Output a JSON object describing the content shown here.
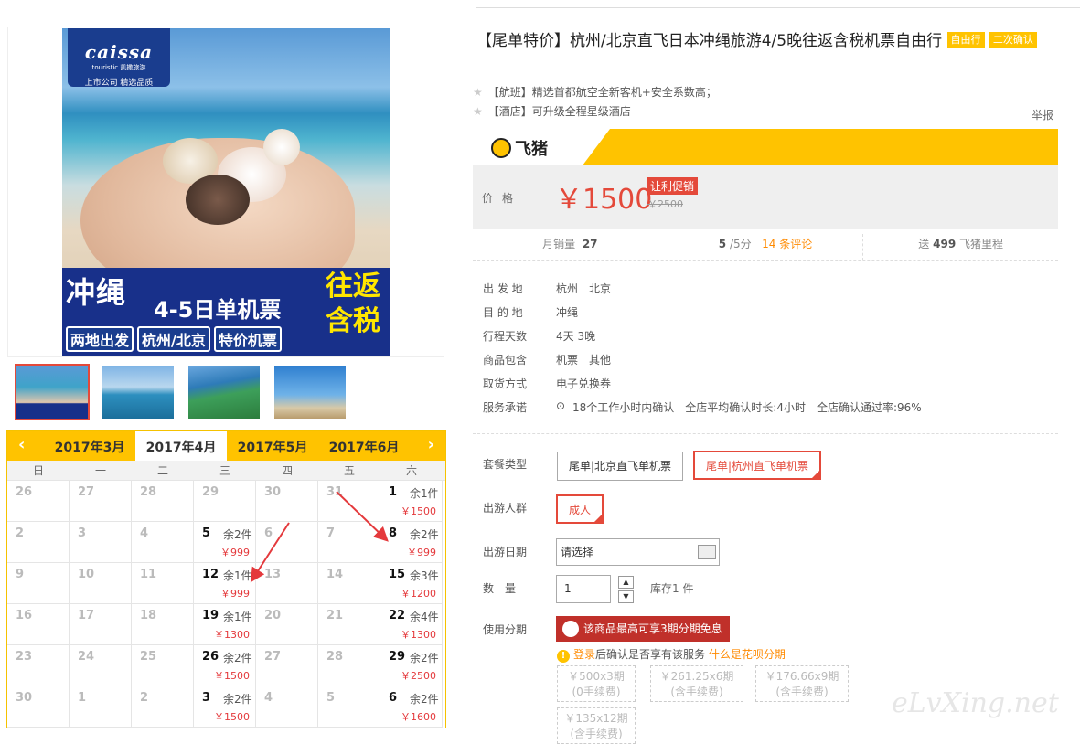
{
  "product": {
    "title": "【尾单特价】杭州/北京直飞日本冲绳旅游4/5晚往返含税机票自由行",
    "badge1": "自由行",
    "badge2": "二次确认",
    "features": [
      "【航班】精选首都航空全新客机+安全系数高；",
      "【酒店】可升级全程星级酒店"
    ],
    "report": "举报"
  },
  "poster": {
    "brand": "caissa",
    "brand_sub": "touristic 凯撒旅游",
    "brand_tag": "上市公司 精选品质",
    "headline": "冲绳",
    "subhead": "4-5日单机票",
    "tags": [
      "两地出发",
      "杭州/北京",
      "特价机票"
    ],
    "side1": "往返",
    "side2": "含税"
  },
  "feizhu": {
    "logo": "飞猪"
  },
  "price": {
    "label": "价格",
    "current": "￥1500",
    "promo": "让利促销",
    "original": "￥2500"
  },
  "stats": {
    "sales_label": "月销量",
    "sales": "27",
    "rating": "5",
    "rating_unit": "/5分",
    "reviews": "14 条评论",
    "points_prefix": "送",
    "points": "499",
    "points_suffix": "飞猪里程"
  },
  "info": [
    {
      "label": "出 发 地",
      "value": "杭州　北京"
    },
    {
      "label": "目 的 地",
      "value": "冲绳"
    },
    {
      "label": "行程天数",
      "value": "4天 3晚"
    },
    {
      "label": "商品包含",
      "value": "机票　其他"
    },
    {
      "label": "取货方式",
      "value": "电子兑换券"
    },
    {
      "label": "服务承诺",
      "value": "18个工作小时内确认　全店平均确认时长:4小时　全店确认通过率:96%"
    }
  ],
  "options": {
    "package_label": "套餐类型",
    "packages": [
      "尾单|北京直飞单机票",
      "尾单|杭州直飞单机票"
    ],
    "traveler_label": "出游人群",
    "traveler": "成人",
    "date_label": "出游日期",
    "date_placeholder": "请选择",
    "qty_label": "数　量",
    "qty": "1",
    "stock": "库存1 件",
    "installment_label": "使用分期",
    "huabei": "该商品最高可享3期分期免息",
    "notice_login": "登录",
    "notice_text": "后确认是否享有该服务",
    "notice_link": "什么是花呗分期",
    "installments": [
      {
        "amount": "￥500x3期",
        "fee": "(0手续费)"
      },
      {
        "amount": "￥261.25x6期",
        "fee": "(含手续费)"
      },
      {
        "amount": "￥176.66x9期",
        "fee": "(含手续费)"
      },
      {
        "amount": "￥135x12期",
        "fee": "(含手续费)"
      }
    ]
  },
  "calendar": {
    "months": [
      "2017年3月",
      "2017年4月",
      "2017年5月",
      "2017年6月"
    ],
    "current_month_index": 1,
    "weekdays": [
      "日",
      "一",
      "二",
      "三",
      "四",
      "五",
      "六"
    ],
    "days": [
      {
        "d": "26"
      },
      {
        "d": "27"
      },
      {
        "d": "28"
      },
      {
        "d": "29"
      },
      {
        "d": "30"
      },
      {
        "d": "31"
      },
      {
        "d": "1",
        "rem": "余1件",
        "price": "￥1500"
      },
      {
        "d": "2"
      },
      {
        "d": "3"
      },
      {
        "d": "4"
      },
      {
        "d": "5",
        "rem": "余2件",
        "price": "￥999"
      },
      {
        "d": "6"
      },
      {
        "d": "7"
      },
      {
        "d": "8",
        "rem": "余2件",
        "price": "￥999"
      },
      {
        "d": "9"
      },
      {
        "d": "10"
      },
      {
        "d": "11"
      },
      {
        "d": "12",
        "rem": "余1件",
        "price": "￥999"
      },
      {
        "d": "13"
      },
      {
        "d": "14"
      },
      {
        "d": "15",
        "rem": "余3件",
        "price": "￥1200"
      },
      {
        "d": "16"
      },
      {
        "d": "17"
      },
      {
        "d": "18"
      },
      {
        "d": "19",
        "rem": "余1件",
        "price": "￥1300"
      },
      {
        "d": "20"
      },
      {
        "d": "21"
      },
      {
        "d": "22",
        "rem": "余4件",
        "price": "￥1300"
      },
      {
        "d": "23"
      },
      {
        "d": "24"
      },
      {
        "d": "25"
      },
      {
        "d": "26",
        "rem": "余2件",
        "price": "￥1500"
      },
      {
        "d": "27"
      },
      {
        "d": "28"
      },
      {
        "d": "29",
        "rem": "余2件",
        "price": "￥2500"
      },
      {
        "d": "30"
      },
      {
        "d": "1"
      },
      {
        "d": "2"
      },
      {
        "d": "3",
        "rem": "余2件",
        "price": "￥1500"
      },
      {
        "d": "4"
      },
      {
        "d": "5"
      },
      {
        "d": "6",
        "rem": "余2件",
        "price": "￥1600"
      }
    ]
  },
  "watermark": "eLvXing.net",
  "colors": {
    "accent": "#ffc300",
    "price_red": "#e4493a"
  }
}
